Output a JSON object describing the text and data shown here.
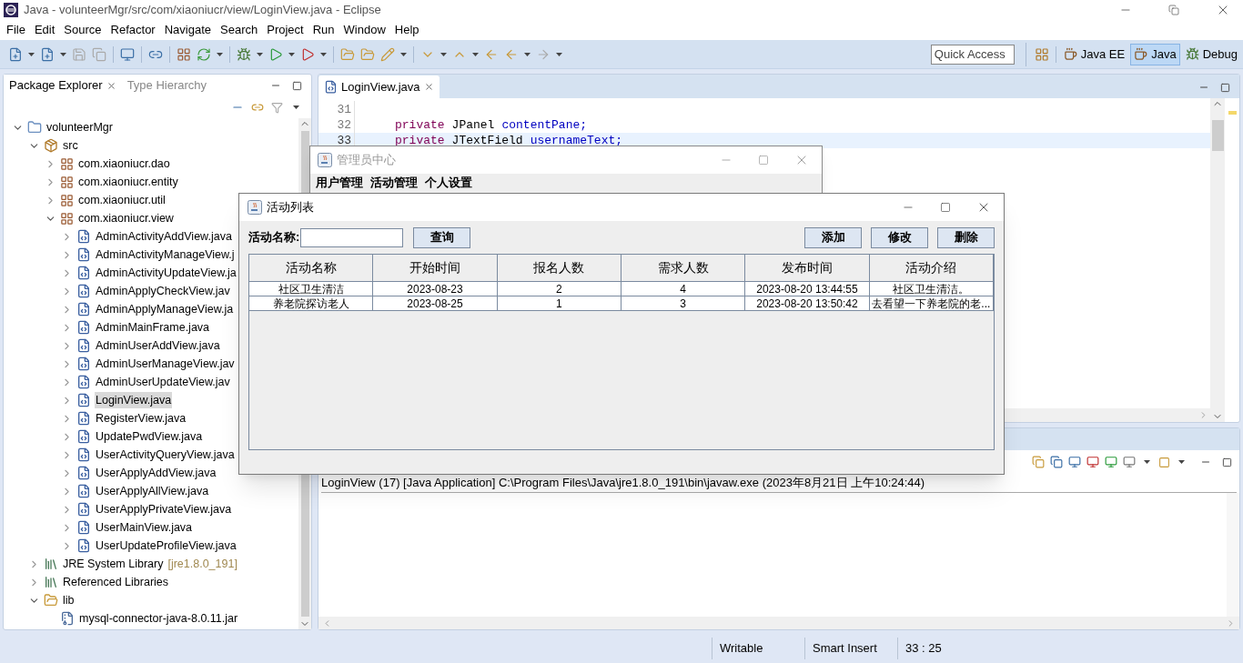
{
  "window": {
    "title": "Java - volunteerMgr/src/com/xiaoniucr/view/LoginView.java - Eclipse"
  },
  "menu": [
    "File",
    "Edit",
    "Source",
    "Refactor",
    "Navigate",
    "Search",
    "Project",
    "Run",
    "Window",
    "Help"
  ],
  "quick_access": {
    "placeholder": "Quick Access"
  },
  "perspectives": [
    {
      "label": "Java EE",
      "selected": false
    },
    {
      "label": "Java",
      "selected": true
    },
    {
      "label": "Debug",
      "selected": false
    }
  ],
  "left_panel": {
    "tabs": [
      {
        "label": "Package Explorer",
        "selected": true
      },
      {
        "label": "Type Hierarchy",
        "selected": false
      }
    ],
    "tree": [
      {
        "label": "volunteerMgr",
        "kind": "project",
        "expanded": true,
        "selected": false,
        "children": [
          {
            "label": "src",
            "kind": "source",
            "expanded": true,
            "selected": false,
            "children": [
              {
                "label": "com.xiaoniucr.dao",
                "kind": "package",
                "expanded": false,
                "selected": false
              },
              {
                "label": "com.xiaoniucr.entity",
                "kind": "package",
                "expanded": false,
                "selected": false
              },
              {
                "label": "com.xiaoniucr.util",
                "kind": "package",
                "expanded": false,
                "selected": false
              },
              {
                "label": "com.xiaoniucr.view",
                "kind": "package",
                "expanded": true,
                "selected": false,
                "children": [
                  {
                    "label": "AdminActivityAddView.java",
                    "kind": "java",
                    "expanded": false,
                    "selected": false
                  },
                  {
                    "label": "AdminActivityManageView.j",
                    "kind": "java",
                    "expanded": false,
                    "selected": false
                  },
                  {
                    "label": "AdminActivityUpdateView.ja",
                    "kind": "java",
                    "expanded": false,
                    "selected": false
                  },
                  {
                    "label": "AdminApplyCheckView.jav",
                    "kind": "java",
                    "expanded": false,
                    "selected": false
                  },
                  {
                    "label": "AdminApplyManageView.ja",
                    "kind": "java",
                    "expanded": false,
                    "selected": false
                  },
                  {
                    "label": "AdminMainFrame.java",
                    "kind": "java",
                    "expanded": false,
                    "selected": false
                  },
                  {
                    "label": "AdminUserAddView.java",
                    "kind": "java",
                    "expanded": false,
                    "selected": false
                  },
                  {
                    "label": "AdminUserManageView.jav",
                    "kind": "java",
                    "expanded": false,
                    "selected": false
                  },
                  {
                    "label": "AdminUserUpdateView.jav",
                    "kind": "java",
                    "expanded": false,
                    "selected": false
                  },
                  {
                    "label": "LoginView.java",
                    "kind": "java",
                    "expanded": false,
                    "selected": true
                  },
                  {
                    "label": "RegisterView.java",
                    "kind": "java",
                    "expanded": false,
                    "selected": false
                  },
                  {
                    "label": "UpdatePwdView.java",
                    "kind": "java",
                    "expanded": false,
                    "selected": false
                  },
                  {
                    "label": "UserActivityQueryView.java",
                    "kind": "java",
                    "expanded": false,
                    "selected": false
                  },
                  {
                    "label": "UserApplyAddView.java",
                    "kind": "java",
                    "expanded": false,
                    "selected": false
                  },
                  {
                    "label": "UserApplyAllView.java",
                    "kind": "java",
                    "expanded": false,
                    "selected": false
                  },
                  {
                    "label": "UserApplyPrivateView.java",
                    "kind": "java",
                    "expanded": false,
                    "selected": false
                  },
                  {
                    "label": "UserMainView.java",
                    "kind": "java",
                    "expanded": false,
                    "selected": false
                  },
                  {
                    "label": "UserUpdateProfileView.java",
                    "kind": "java",
                    "expanded": false,
                    "selected": false
                  }
                ]
              }
            ]
          },
          {
            "label": "JRE System Library",
            "note": "[jre1.8.0_191]",
            "kind": "library",
            "expanded": false,
            "selected": false
          },
          {
            "label": "Referenced Libraries",
            "kind": "library",
            "expanded": false,
            "selected": false
          },
          {
            "label": "lib",
            "kind": "folder",
            "expanded": true,
            "selected": false,
            "children": [
              {
                "label": "mysql-connector-java-8.0.11.jar",
                "kind": "jar",
                "selected": false
              }
            ]
          }
        ]
      }
    ]
  },
  "editor": {
    "tabs": [
      {
        "label": "LoginView.java",
        "selected": true
      }
    ],
    "lines": [
      {
        "number": "31",
        "current": false
      },
      {
        "number": "32",
        "current": false,
        "tokens": [
          {
            "kind": "keyword",
            "text": "private"
          },
          {
            "kind": "plain",
            "text": "JPanel"
          },
          {
            "kind": "field",
            "text": "contentPane;"
          }
        ]
      },
      {
        "number": "33",
        "current": true,
        "tokens": [
          {
            "kind": "keyword",
            "text": "private"
          },
          {
            "kind": "plain",
            "text": "JTextField"
          },
          {
            "kind": "field",
            "text": "usernameText;"
          }
        ]
      }
    ]
  },
  "console": {
    "header": "LoginView (17) [Java Application] C:\\Program Files\\Java\\jre1.8.0_191\\bin\\javaw.exe (2023年8月21日 上午10:24:44)"
  },
  "status_bar": [
    "Writable",
    "Smart Insert",
    "33 : 25"
  ],
  "admin_window": {
    "title": "管理员中心",
    "menu": [
      "用户管理",
      "活动管理",
      "个人设置"
    ]
  },
  "activity_dialog": {
    "title": "活动列表",
    "search_label": "活动名称:",
    "search_button": "查询",
    "actions": [
      "添加",
      "修改",
      "删除"
    ],
    "columns": [
      "活动名称",
      "开始时间",
      "报名人数",
      "需求人数",
      "发布时间",
      "活动介绍"
    ],
    "rows": [
      [
        "社区卫生清洁",
        "2023-08-23",
        "2",
        "4",
        "2023-08-20 13:44:55",
        "社区卫生清洁。"
      ],
      [
        "养老院探访老人",
        "2023-08-25",
        "1",
        "3",
        "2023-08-20 13:50:42",
        "去看望一下养老院的老..."
      ]
    ]
  }
}
